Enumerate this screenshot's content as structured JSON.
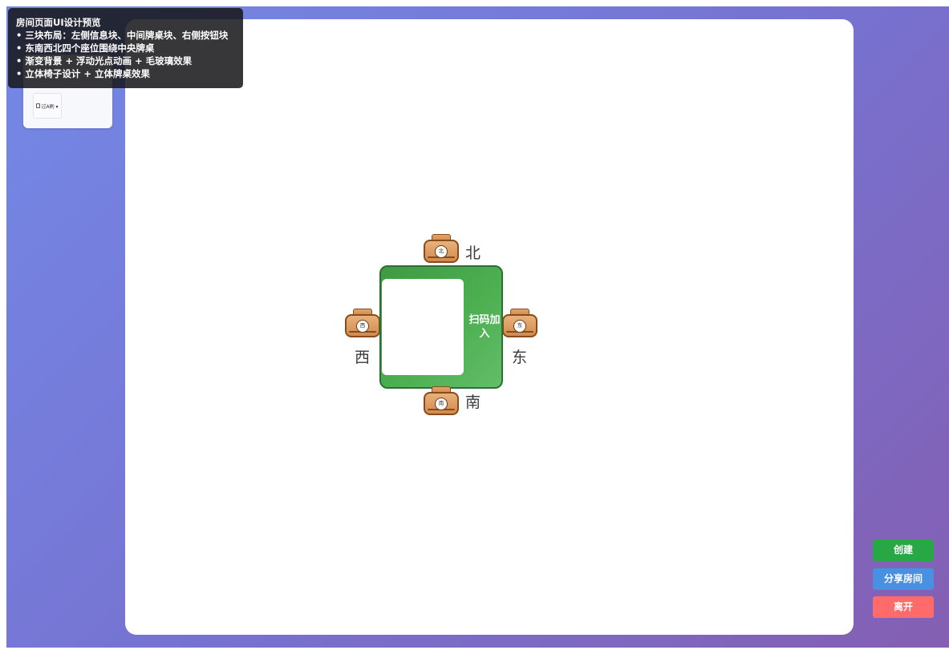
{
  "tooltip": {
    "title": "房间页面UI设计预览",
    "lines": [
      "• 三块布局：左侧信息块、中间牌桌块、右侧按钮块",
      "• 东南西北四个座位围绕中央牌桌",
      "• 渐变背景 + 浮动光点动画 + 毛玻璃效果",
      "• 立体椅子设计 + 立体牌桌效果"
    ]
  },
  "left_panel": {
    "chip_label": "过A刷 ▾",
    "chip_icon": "doc-icon"
  },
  "table": {
    "scan_label": "扫码加入",
    "colors": {
      "felt": "#4caf50",
      "border": "#2f6f34"
    }
  },
  "seats": {
    "north": {
      "label": "北",
      "badge": "北"
    },
    "south": {
      "label": "南",
      "badge": "南"
    },
    "west": {
      "label": "西",
      "badge": "西"
    },
    "east": {
      "label": "东",
      "badge": "东"
    }
  },
  "buttons": {
    "create": "创建",
    "share": "分享房间",
    "leave": "离开"
  },
  "colors": {
    "background_start": "#7489e6",
    "background_end": "#845fb2",
    "create": "#28a745",
    "share": "#4a90e2",
    "leave": "#ff6b6b"
  }
}
